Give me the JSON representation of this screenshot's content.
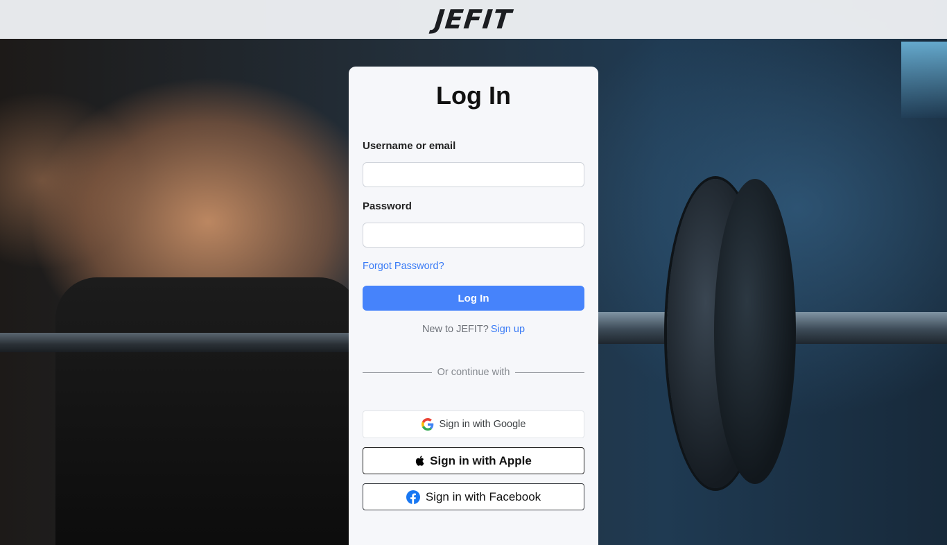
{
  "header": {
    "logo_text": "JEFIT"
  },
  "login": {
    "title": "Log In",
    "username_label": "Username or email",
    "username_value": "",
    "password_label": "Password",
    "password_value": "",
    "forgot_password": "Forgot Password?",
    "submit_label": "Log In",
    "new_user_text": "New to JEFIT?",
    "signup_link": "Sign up",
    "divider_text": "Or continue with"
  },
  "social": {
    "google_label": "Sign in with Google",
    "apple_label": "Sign in with Apple",
    "facebook_label": "Sign in with Facebook"
  },
  "colors": {
    "primary": "#4683fb",
    "link": "#3a7bf5",
    "card_bg": "#f6f7fa",
    "facebook": "#1877f2"
  },
  "icons": [
    "google-icon",
    "apple-icon",
    "facebook-icon"
  ]
}
